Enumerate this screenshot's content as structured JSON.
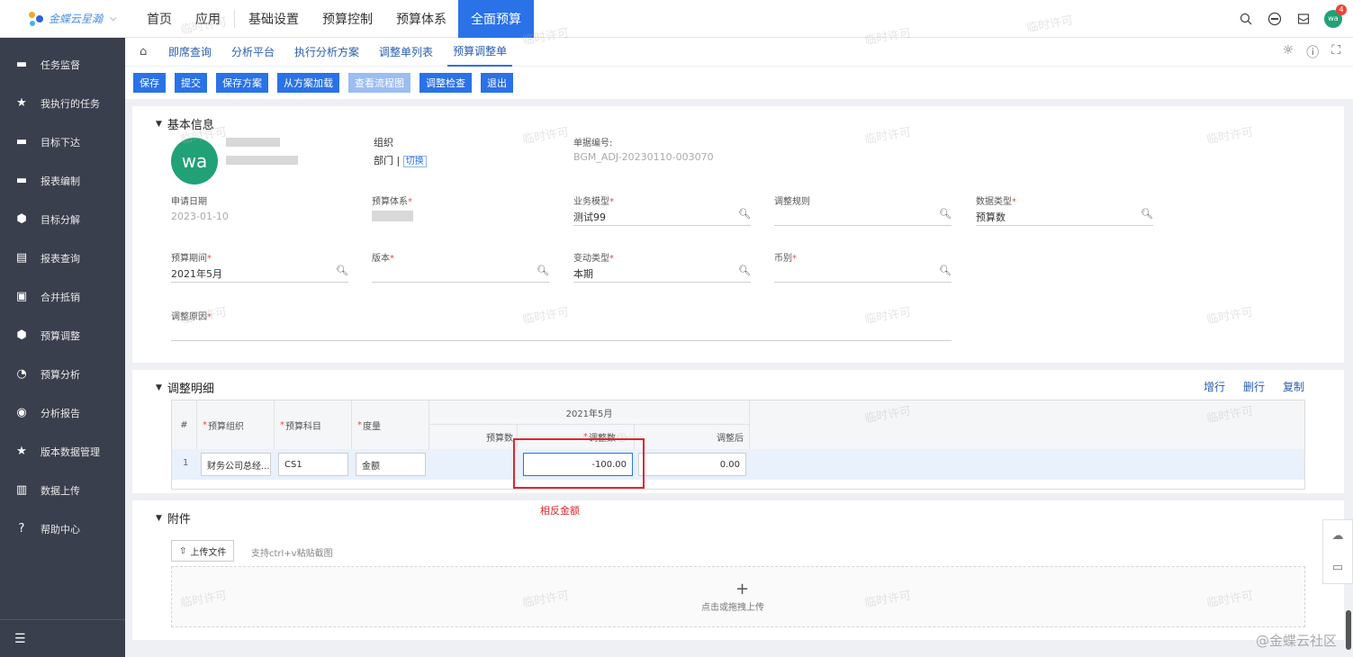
{
  "brand": {
    "name": "金蝶云",
    "suffix": "星瀚"
  },
  "topnav": {
    "items": [
      "首页",
      "应用",
      "基础设置",
      "预算控制",
      "预算体系",
      "全面预算"
    ],
    "active_index": 5
  },
  "user": {
    "initials": "wa",
    "badge": "4"
  },
  "sidebar": {
    "items": [
      {
        "label": "任务监督",
        "icon": "monitor-icon"
      },
      {
        "label": "我执行的任务",
        "icon": "star-icon"
      },
      {
        "label": "目标下达",
        "icon": "monitor-icon"
      },
      {
        "label": "报表编制",
        "icon": "monitor-icon"
      },
      {
        "label": "目标分解",
        "icon": "cube-icon"
      },
      {
        "label": "报表查询",
        "icon": "report-icon"
      },
      {
        "label": "合并抵销",
        "icon": "merge-icon"
      },
      {
        "label": "预算调整",
        "icon": "cube-icon"
      },
      {
        "label": "预算分析",
        "icon": "pie-icon"
      },
      {
        "label": "分析报告",
        "icon": "target-icon"
      },
      {
        "label": "版本数据管理",
        "icon": "star-icon"
      },
      {
        "label": "数据上传",
        "icon": "upload-icon"
      },
      {
        "label": "帮助中心",
        "icon": "help-icon"
      }
    ]
  },
  "breadcrumbs": [
    "即席查询",
    "分析平台",
    "执行分析方案",
    "调整单列表",
    "预算调整单"
  ],
  "toolbar": [
    "保存",
    "提交",
    "保存方案",
    "从方案加载",
    "查看流程图",
    "调整检查",
    "退出"
  ],
  "basic_info": {
    "title": "基本信息",
    "org_label": "组织",
    "dept_label": "部门",
    "switch_label": "切换",
    "bill_no_label": "单据编号:",
    "bill_no": "BGM_ADJ-20230110-003070",
    "apply_date_label": "申请日期",
    "apply_date": "2023-01-10",
    "budget_system_label": "预算体系",
    "business_model_label": "业务模型",
    "business_model": "测试99",
    "adjust_rule_label": "调整规则",
    "data_type_label": "数据类型",
    "data_type": "预算数",
    "period_label": "预算期间",
    "period": "2021年5月",
    "version_label": "版本",
    "change_type_label": "变动类型",
    "change_type": "本期",
    "currency_label": "币别",
    "reason_label": "调整原因"
  },
  "detail": {
    "title": "调整明细",
    "actions": [
      "增行",
      "删行",
      "复制"
    ],
    "columns": {
      "num": "#",
      "org": "预算组织",
      "account": "预算科目",
      "measure": "度量",
      "period_group": "2021年5月",
      "budget": "预算数",
      "adjust": "调整数",
      "after": "调整后"
    },
    "rows": [
      {
        "num": "1",
        "org": "财务公司总经...",
        "account": "CS1",
        "measure": "金额",
        "budget": "",
        "adjust": "-100.00",
        "after": "0.00"
      }
    ],
    "annotation": "相反金额"
  },
  "attachment": {
    "title": "附件",
    "upload_label": "上传文件",
    "tip": "支持ctrl+v粘贴截图",
    "drop_text": "点击或拖拽上传"
  },
  "watermark": "临时许可",
  "community": "@金蝶云社区"
}
